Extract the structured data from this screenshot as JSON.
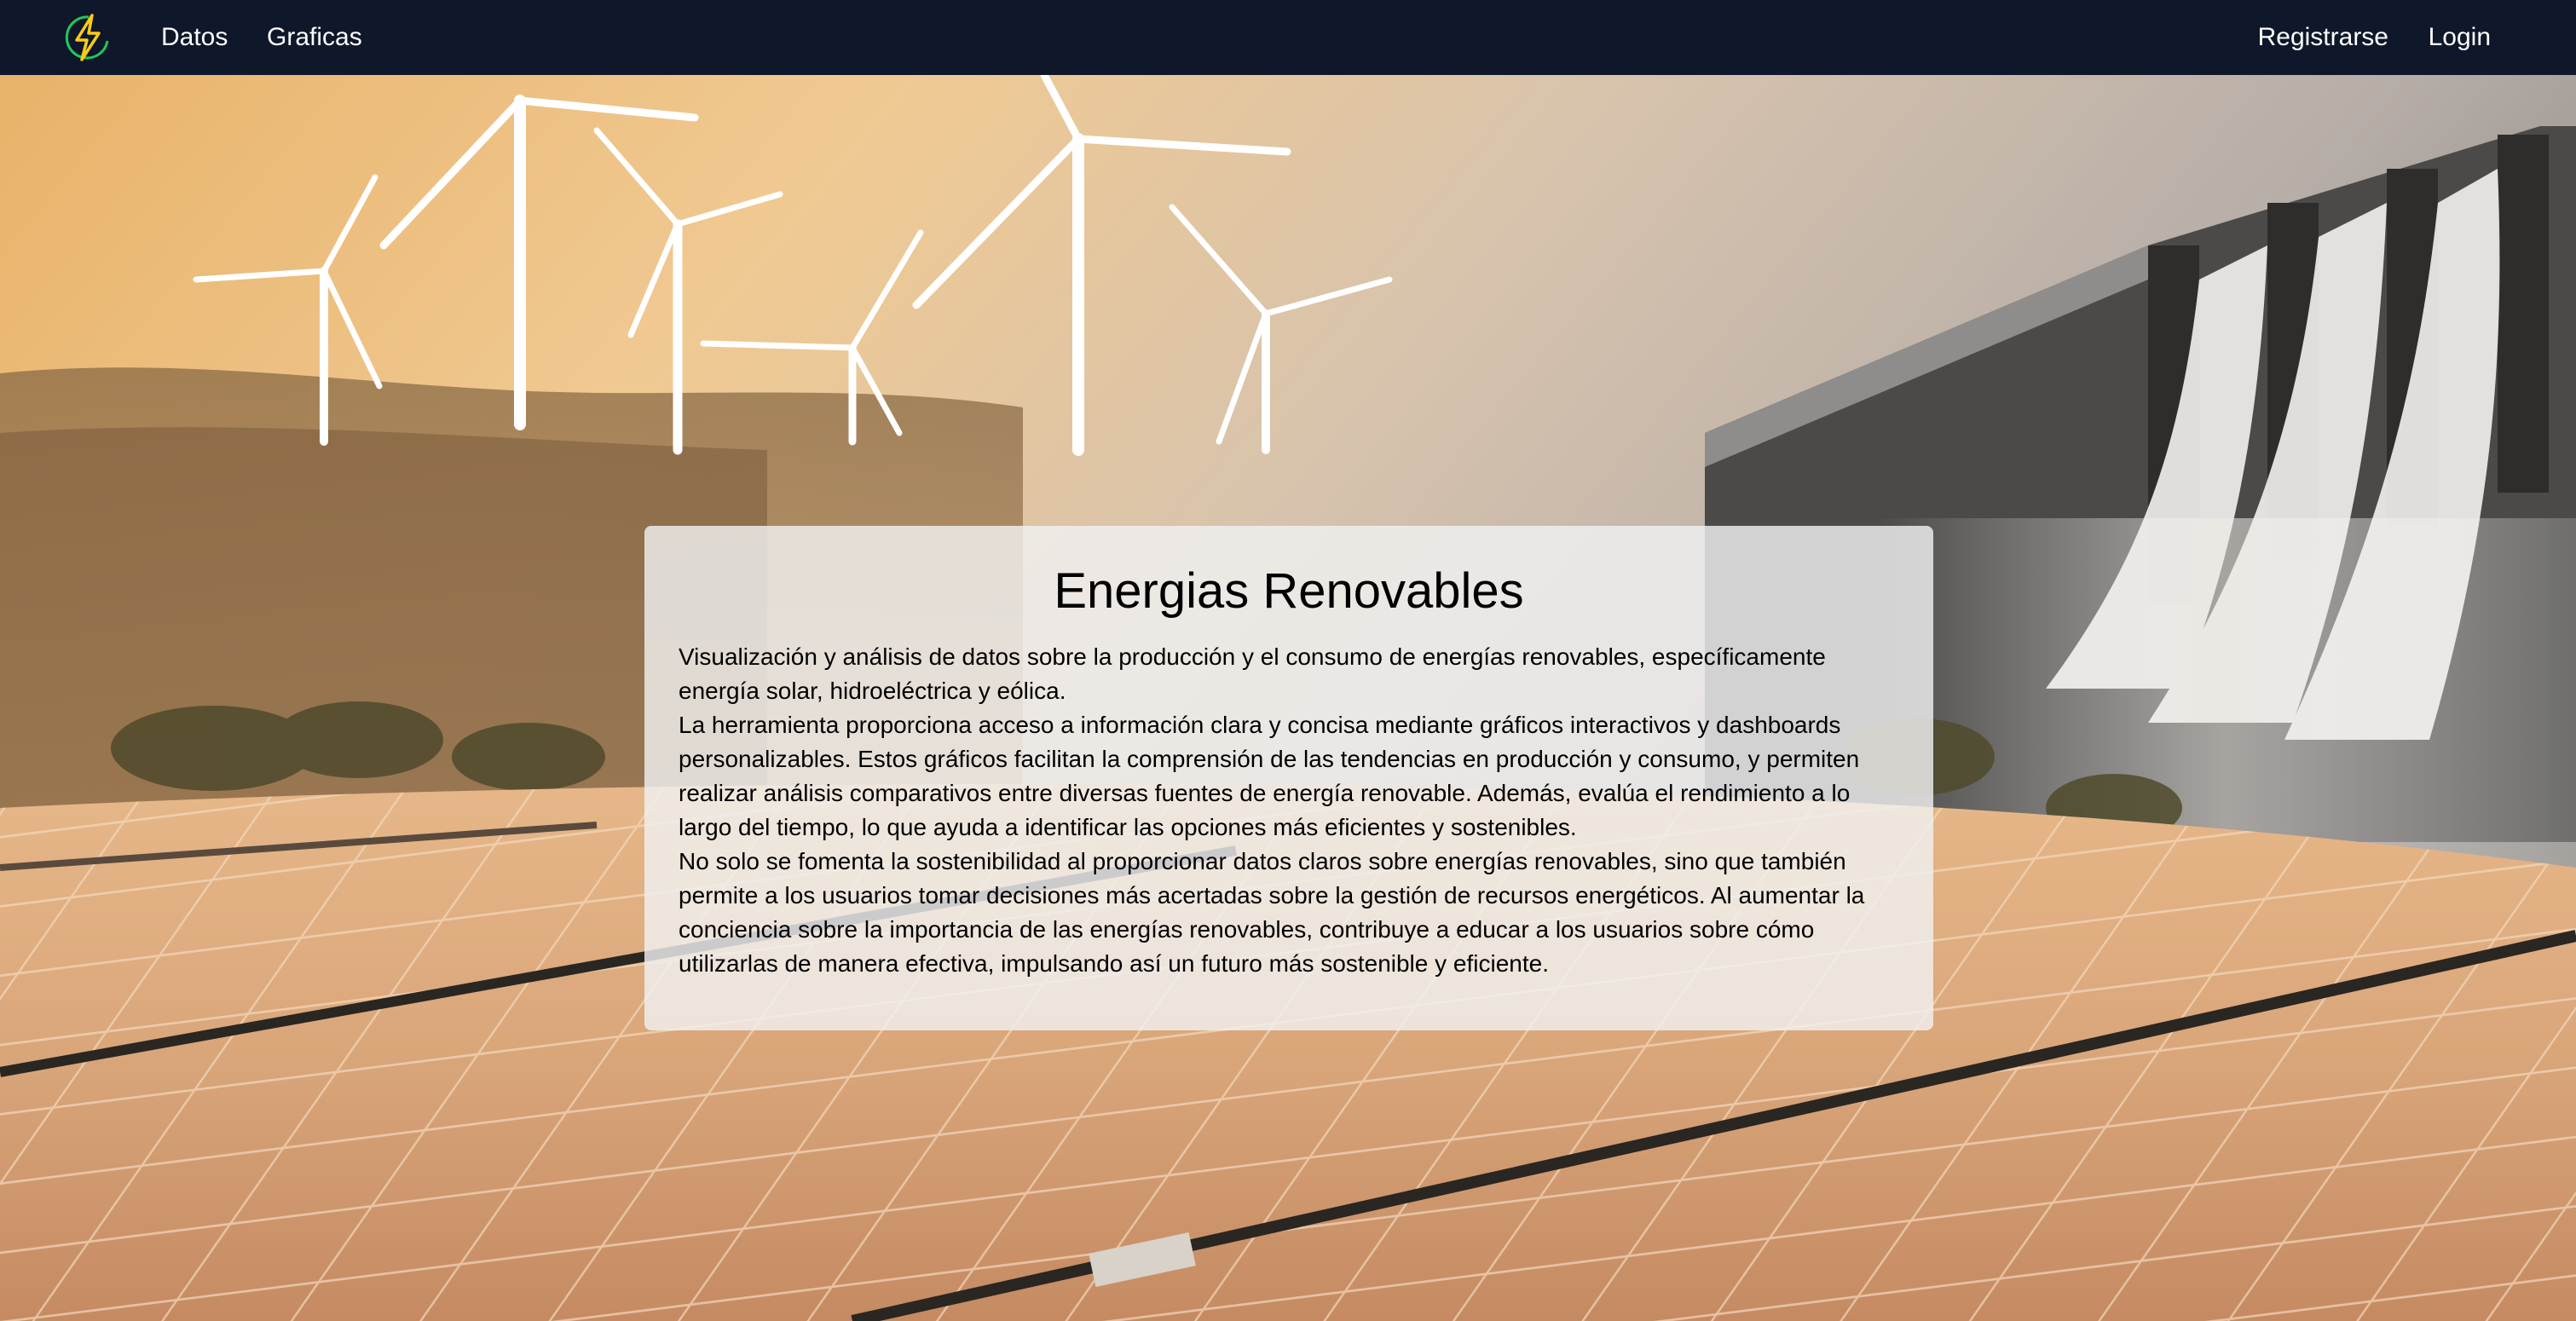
{
  "navbar": {
    "logo_icon": "lightning-bolt-icon",
    "links_left": [
      "Datos",
      "Graficas"
    ],
    "links_right": [
      "Registrarse",
      "Login"
    ],
    "background": "#0f172a",
    "logo_color": "#facc15",
    "logo_ring_color": "#22c55e"
  },
  "hero": {
    "background_image": "wind-turbines-dam-solar-panels",
    "card": {
      "title": "Energias Renovables",
      "paragraphs": [
        "Visualización y análisis de datos sobre la producción y el consumo de energías renovables, específicamente energía solar, hidroeléctrica y eólica.",
        "La herramienta proporciona acceso a información clara y concisa mediante gráficos interactivos y dashboards personalizables. Estos gráficos facilitan la comprensión de las tendencias en producción y consumo, y permiten realizar análisis comparativos entre diversas fuentes de energía renovable. Además, evalúa el rendimiento a lo largo del tiempo, lo que ayuda a identificar las opciones más eficientes y sostenibles.",
        "No solo se fomenta la sostenibilidad al proporcionar datos claros sobre energías renovables, sino que también permite a los usuarios tomar decisiones más acertadas sobre la gestión de recursos energéticos. Al aumentar la conciencia sobre la importancia de las energías renovables, contribuye a educar a los usuarios sobre cómo utilizarlas de manera efectiva, impulsando así un futuro más sostenible y eficiente."
      ]
    }
  }
}
